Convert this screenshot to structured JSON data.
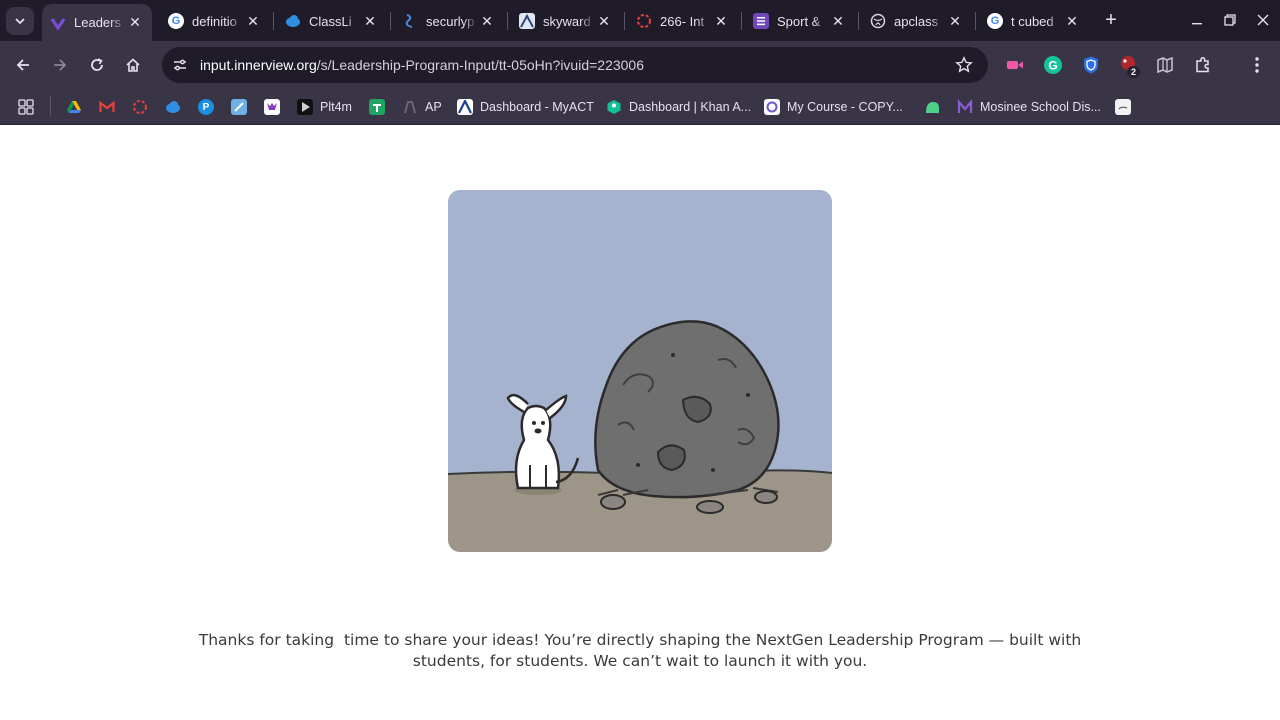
{
  "browser": {
    "tabs": [
      {
        "title": "Leaders",
        "icon": "innerview-icon",
        "active": true
      },
      {
        "title": "definitio",
        "icon": "google-icon"
      },
      {
        "title": "ClassLi",
        "icon": "classlink-icon"
      },
      {
        "title": "securlyp",
        "icon": "securly-icon"
      },
      {
        "title": "skyward",
        "icon": "skyward-icon"
      },
      {
        "title": "266- Int",
        "icon": "ring-icon"
      },
      {
        "title": "Sport &",
        "icon": "form-icon"
      },
      {
        "title": "apclass",
        "icon": "globe-icon"
      },
      {
        "title": "t cubed",
        "icon": "google-icon"
      }
    ],
    "address": {
      "host": "input.innerview.org",
      "path": "/s/Leadership-Program-Input/tt-05oHn?ivuid=223006"
    },
    "extension_badge": "2",
    "bookmarks": [
      {
        "label": "",
        "icon": "drive-icon"
      },
      {
        "label": "",
        "icon": "gmail-icon"
      },
      {
        "label": "",
        "icon": "ring-icon"
      },
      {
        "label": "",
        "icon": "classlink-icon"
      },
      {
        "label": "",
        "icon": "pearson-icon"
      },
      {
        "label": "",
        "icon": "app-icon"
      },
      {
        "label": "",
        "icon": "cat-icon"
      },
      {
        "label": "Plt4m",
        "icon": "plt4m-icon"
      },
      {
        "label": "",
        "icon": "sheets-icon"
      },
      {
        "label": "AP",
        "icon": "ap-icon"
      },
      {
        "label": "Dashboard - MyACT",
        "icon": "act-icon"
      },
      {
        "label": "Dashboard | Khan A...",
        "icon": "khan-icon"
      },
      {
        "label": "My Course - COPY...",
        "icon": "course-icon"
      },
      {
        "label": "",
        "icon": "green-blob-icon"
      },
      {
        "label": "Mosinee School Dis...",
        "icon": "mosinee-icon"
      },
      {
        "label": "",
        "icon": "doc-icon"
      }
    ]
  },
  "page": {
    "thanks_message": "Thanks for taking  time to share your ideas! You’re directly shaping the NextGen Leadership Program — built with\nstudents, for students. We can’t wait to launch it with you."
  },
  "colors": {
    "sky": "#a5b3ce",
    "ground": "#9d9688",
    "rock": "#6f6f6f",
    "chrome_bg": "#3a3447"
  }
}
